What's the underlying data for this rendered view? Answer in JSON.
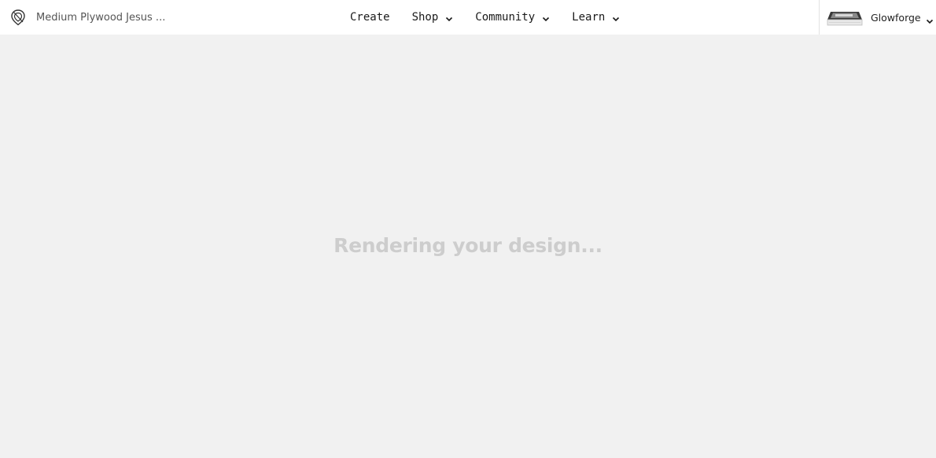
{
  "header": {
    "document_title": "Medium Plywood Jesus ...",
    "nav": [
      {
        "label": "Create",
        "has_dropdown": false
      },
      {
        "label": "Shop",
        "has_dropdown": true
      },
      {
        "label": "Community",
        "has_dropdown": true
      },
      {
        "label": "Learn",
        "has_dropdown": true
      }
    ],
    "machine": {
      "name": "Glowforge",
      "icon": "chevron-down-icon"
    }
  },
  "main": {
    "status_text": "Rendering your design..."
  },
  "colors": {
    "header_bg": "#ffffff",
    "canvas_bg": "#f1f1f1",
    "status_text": "#cdcdcd"
  }
}
